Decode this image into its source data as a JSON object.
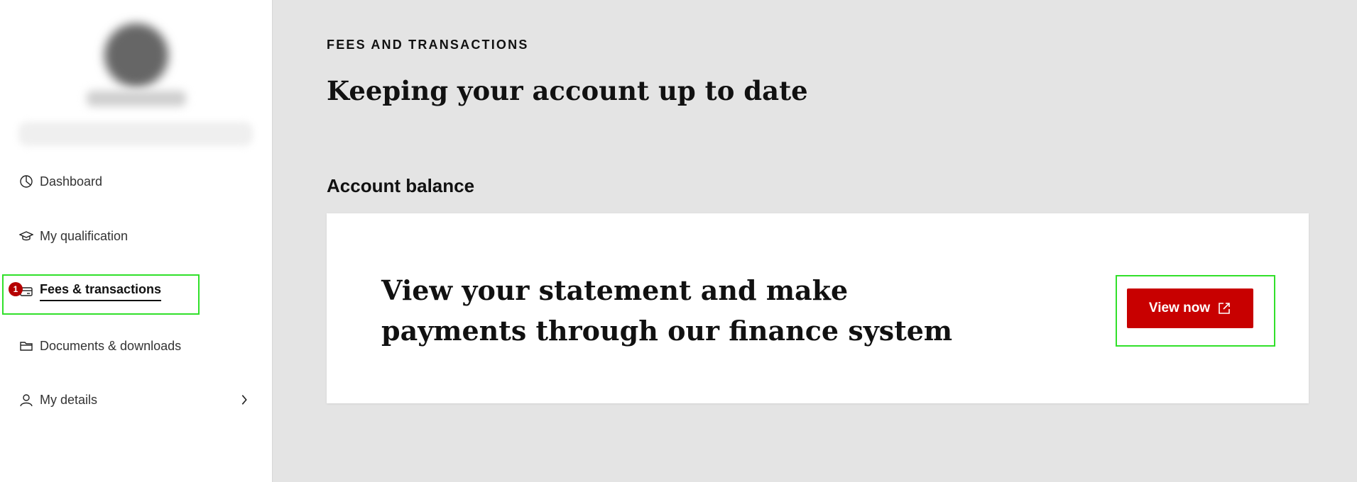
{
  "sidebar": {
    "items": [
      {
        "label": "Dashboard",
        "icon": "dashboard-pie-icon"
      },
      {
        "label": "My qualification",
        "icon": "graduation-cap-icon"
      },
      {
        "label": "Fees & transactions",
        "icon": "card-icon",
        "active": true,
        "marker": "1"
      },
      {
        "label": "Documents & downloads",
        "icon": "folder-icon"
      },
      {
        "label": "My details",
        "icon": "user-icon",
        "chevron": "chevron-right-icon"
      }
    ]
  },
  "main": {
    "eyebrow": "FEES AND TRANSACTIONS",
    "title": "Keeping your account up to date",
    "section_title": "Account balance",
    "card": {
      "text": "View your statement and make payments through our finance system",
      "button_label": "View now",
      "button_icon": "external-link-icon"
    }
  },
  "colors": {
    "accent": "#c80000",
    "background": "#e4e4e4",
    "highlight": "#31e02a"
  }
}
